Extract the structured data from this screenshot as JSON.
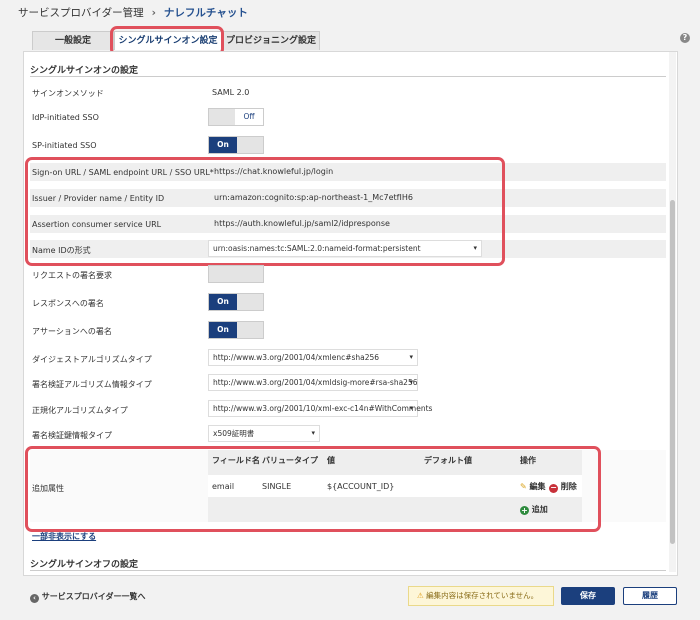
{
  "breadcrumb": {
    "parent": "サービスプロバイダー管理",
    "separator": "›",
    "current": "ナレフルチャット"
  },
  "help_icon_glyph": "?",
  "tabs": [
    {
      "label": "一般設定"
    },
    {
      "label": "シングルサインオン設定"
    },
    {
      "label": "プロビジョニング設定"
    }
  ],
  "sso": {
    "section_title": "シングルサインオンの設定",
    "method_label": "サインオンメソッド",
    "method_value": "SAML 2.0",
    "idp_initiated_label": "IdP-initiated SSO",
    "idp_initiated_state": "Off",
    "sp_initiated_label": "SP-initiated SSO",
    "sp_initiated_state": "On",
    "signon_url_label": "Sign-on URL / SAML endpoint URL / SSO URL*",
    "signon_url_value": "https://chat.knowleful.jp/login",
    "issuer_label": "Issuer / Provider name / Entity ID",
    "issuer_value": "urn:amazon:cognito:sp:ap-northeast-1_Mc7etfIH6",
    "acs_label": "Assertion consumer service URL",
    "acs_value": "https://auth.knowleful.jp/saml2/idpresponse",
    "nameid_label": "Name IDの形式",
    "nameid_value": "urn:oasis:names:tc:SAML:2.0:nameid-format:persistent",
    "req_sign_label": "リクエストの署名要求",
    "resp_sign_label": "レスポンスへの署名",
    "resp_sign_state": "On",
    "assertion_sign_label": "アサーションへの署名",
    "assertion_sign_state": "On",
    "digest_label": "ダイジェストアルゴリズムタイプ",
    "digest_value": "http://www.w3.org/2001/04/xmlenc#sha256",
    "sigalg_label": "署名検証アルゴリズム情報タイプ",
    "sigalg_value": "http://www.w3.org/2001/04/xmldsig-more#rsa-sha256",
    "canon_label": "正規化アルゴリズムタイプ",
    "canon_value": "http://www.w3.org/2001/10/xml-exc-c14n#WithComments",
    "keyinfo_label": "署名検証鍵情報タイプ",
    "keyinfo_value": "x509証明書",
    "attr_label": "追加属性",
    "attr_columns": [
      "フィールド名",
      "バリュータイプ",
      "値",
      "デフォルト値",
      "操作"
    ],
    "attr_row": {
      "field": "email",
      "type": "SINGLE",
      "value": "${ACCOUNT_ID}",
      "default": ""
    },
    "edit_label": "編集",
    "delete_label": "削除",
    "add_label": "追加",
    "toggle_details_link": "一部非表示にする"
  },
  "slo": {
    "section_title": "シングルサインオフの設定"
  },
  "footer": {
    "back_link": "サービスプロバイダー一覧へ",
    "unsaved_warning": "編集内容は保存されていません。",
    "save_label": "保存",
    "history_label": "履歴"
  },
  "colors": {
    "accent": "#1b3f7d",
    "highlight": "#e0505c",
    "warning_bg": "#fdf6d8",
    "add_green": "#2e8b3e",
    "delete_red": "#c8313a"
  }
}
